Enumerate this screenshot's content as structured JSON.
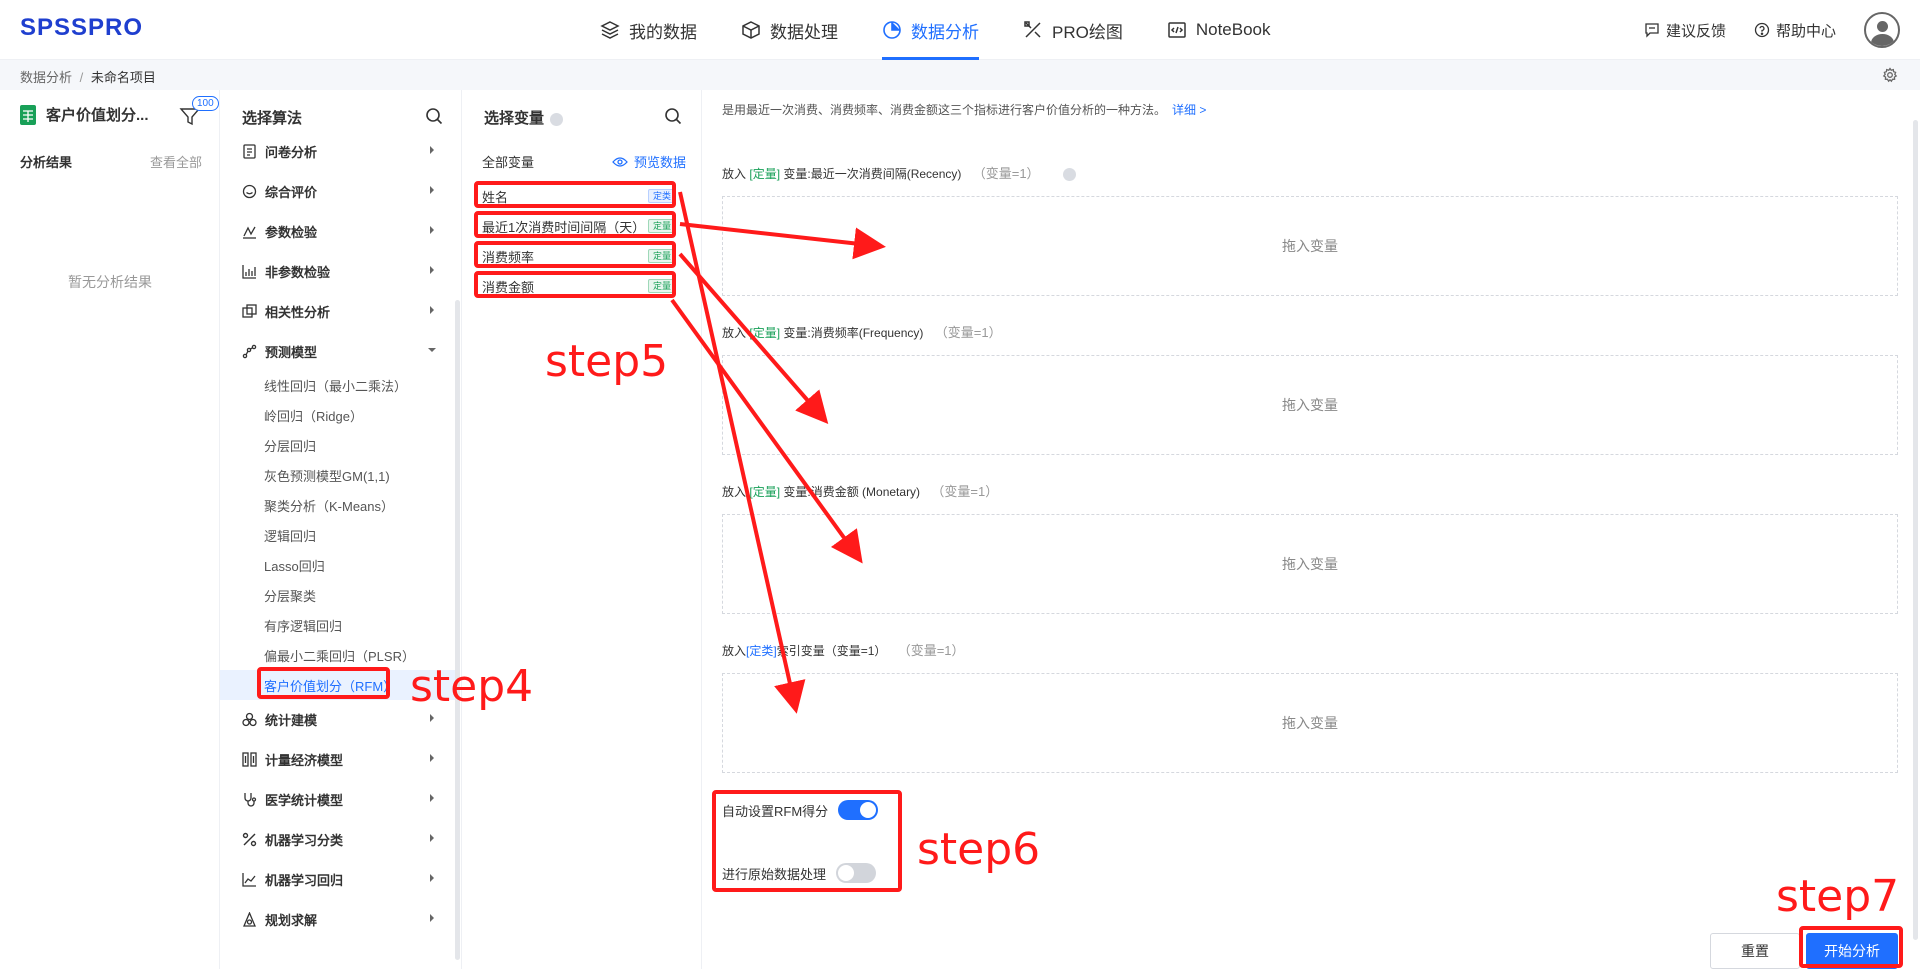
{
  "header": {
    "logo": "SPSSPRO",
    "nav": [
      {
        "label": "我的数据",
        "icon": "layers-icon"
      },
      {
        "label": "数据处理",
        "icon": "cube-icon"
      },
      {
        "label": "数据分析",
        "icon": "pie-chart-icon",
        "active": true
      },
      {
        "label": "PRO绘图",
        "icon": "drawing-tools-icon"
      },
      {
        "label": "NoteBook",
        "icon": "code-icon"
      }
    ],
    "feedback": "建议反馈",
    "help": "帮助中心"
  },
  "breadcrumb": {
    "root": "数据分析",
    "sep": "/",
    "current": "未命名项目"
  },
  "left_panel": {
    "project_name": "客户价值划分...",
    "filter_badge": "100",
    "results_title": "分析结果",
    "view_all": "查看全部",
    "empty_text": "暂无分析结果"
  },
  "algo_panel": {
    "title": "选择算法",
    "categories": [
      {
        "label": "问卷分析",
        "icon": "questionnaire-icon"
      },
      {
        "label": "综合评价",
        "icon": "chat-eval-icon"
      },
      {
        "label": "参数检验",
        "icon": "param-chart-icon"
      },
      {
        "label": "非参数检验",
        "icon": "bar-chart-icon"
      },
      {
        "label": "相关性分析",
        "icon": "correlation-icon"
      },
      {
        "label": "预测模型",
        "icon": "prediction-icon",
        "expanded": true
      }
    ],
    "sub_items": [
      "线性回归（最小二乘法）",
      "岭回归（Ridge）",
      "分层回归",
      "灰色预测模型GM(1,1)",
      "聚类分析（K-Means）",
      "逻辑回归",
      "Lasso回归",
      "分层聚类",
      "有序逻辑回归",
      "偏最小二乘回归（PLSR）",
      "客户价值划分（RFM）"
    ],
    "active_sub": 10,
    "categories_after": [
      {
        "label": "统计建模",
        "icon": "stat-modeling-icon"
      },
      {
        "label": "计量经济模型",
        "icon": "econometric-icon"
      },
      {
        "label": "医学统计模型",
        "icon": "stethoscope-icon"
      },
      {
        "label": "机器学习分类",
        "icon": "percent-icon"
      },
      {
        "label": "机器学习回归",
        "icon": "line-chart-icon"
      },
      {
        "label": "规划求解",
        "icon": "planning-icon"
      }
    ]
  },
  "vars_panel": {
    "title": "选择变量",
    "all_vars": "全部变量",
    "preview": "预览数据",
    "variables": [
      {
        "name": "姓名",
        "tag": "定类",
        "type": "categorical"
      },
      {
        "name": "最近1次消费时间间隔（天）",
        "tag": "定量",
        "type": "quantitative"
      },
      {
        "name": "消费频率",
        "tag": "定量",
        "type": "quantitative"
      },
      {
        "name": "消费金额",
        "tag": "定量",
        "type": "quantitative"
      }
    ]
  },
  "main_panel": {
    "description": "是用最近一次消费、消费频率、消费金额这三个指标进行客户价值分析的一种方法。",
    "detail_link": "详细 >",
    "slots": [
      {
        "prefix": "放入",
        "tag": "[定量]",
        "tag_type": "quantitative",
        "suffix": "变量:最近一次消费间隔(Recency)",
        "count": "（变量=1）",
        "placeholder": "拖入变量"
      },
      {
        "prefix": "放入",
        "tag": "[定量]",
        "tag_type": "quantitative",
        "suffix": "变量:消费频率(Frequency)",
        "count": "（变量=1）",
        "placeholder": "拖入变量"
      },
      {
        "prefix": "放入",
        "tag": "[定量]",
        "tag_type": "quantitative",
        "suffix": "变量:消费金额 (Monetary)",
        "count": "（变量=1）",
        "placeholder": "拖入变量"
      },
      {
        "prefix": "放入",
        "tag": "[定类]",
        "tag_type": "categorical",
        "suffix": "索引变量（变量=1）",
        "count": "（变量=1）",
        "placeholder": "拖入变量"
      }
    ],
    "option_auto_rfm": "自动设置RFM得分",
    "option_raw_process": "进行原始数据处理",
    "reset": "重置",
    "start": "开始分析"
  },
  "annotations": {
    "step4": "step4",
    "step5": "step5",
    "step6": "step6",
    "step7": "step7",
    "color": "#ff1a1a"
  }
}
